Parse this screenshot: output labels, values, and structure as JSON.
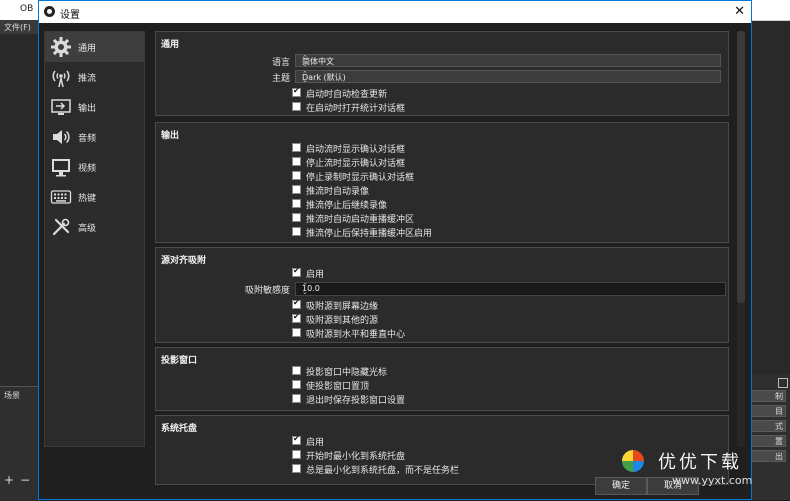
{
  "app": {
    "title_fragment": "OB",
    "menu_file": "文件(F)",
    "scenes_label": "场景",
    "scenes_add": "+",
    "scenes_remove": "−",
    "right_panel_fragments": [
      "制",
      "目",
      "式",
      "置",
      "出"
    ]
  },
  "dialog": {
    "title": "设置",
    "close": "✕",
    "ok_label": "确定",
    "cancel_label": "取消"
  },
  "sidebar": {
    "items": [
      {
        "label": "通用",
        "icon": "gear-icon",
        "active": true
      },
      {
        "label": "推流",
        "icon": "broadcast-tower-icon",
        "active": false
      },
      {
        "label": "输出",
        "icon": "output-monitor-icon",
        "active": false
      },
      {
        "label": "音频",
        "icon": "speaker-icon",
        "active": false
      },
      {
        "label": "视频",
        "icon": "display-icon",
        "active": false
      },
      {
        "label": "热键",
        "icon": "keyboard-icon",
        "active": false
      },
      {
        "label": "高级",
        "icon": "wrench-screwdriver-icon",
        "active": false
      }
    ]
  },
  "general": {
    "title": "通用",
    "language_label": "语言",
    "language_value": "简体中文",
    "theme_label": "主题",
    "theme_value": "Dark (默认)",
    "check_updates": {
      "label": "启动时自动检查更新",
      "checked": true
    },
    "open_stats": {
      "label": "在启动时打开统计对话框",
      "checked": false
    }
  },
  "output": {
    "title": "输出",
    "options": [
      {
        "label": "启动流时显示确认对话框",
        "checked": false
      },
      {
        "label": "停止流时显示确认对话框",
        "checked": false
      },
      {
        "label": "停止录制时显示确认对话框",
        "checked": false
      },
      {
        "label": "推流时自动录像",
        "checked": false
      },
      {
        "label": "推流停止后继续录像",
        "checked": false
      },
      {
        "label": "推流时自动启动重播缓冲区",
        "checked": false
      },
      {
        "label": "推流停止后保持重播缓冲区启用",
        "checked": false
      }
    ]
  },
  "snapping": {
    "title": "源对齐吸附",
    "enable": {
      "label": "启用",
      "checked": true
    },
    "sensitivity_label": "吸附敏感度",
    "sensitivity_value": "10.0",
    "options": [
      {
        "label": "吸附源到屏幕边缘",
        "checked": true
      },
      {
        "label": "吸附源到其他的源",
        "checked": true
      },
      {
        "label": "吸附源到水平和垂直中心",
        "checked": false
      }
    ]
  },
  "projectors": {
    "title": "投影窗口",
    "options": [
      {
        "label": "投影窗口中隐藏光标",
        "checked": false
      },
      {
        "label": "使投影窗口置顶",
        "checked": false
      },
      {
        "label": "退出时保存投影窗口设置",
        "checked": false
      }
    ]
  },
  "tray": {
    "title": "系统托盘",
    "options": [
      {
        "label": "启用",
        "checked": true
      },
      {
        "label": "开始时最小化到系统托盘",
        "checked": false
      },
      {
        "label": "总是最小化到系统托盘，而不是任务栏",
        "checked": false
      }
    ]
  },
  "watermark": {
    "title": "优优下载",
    "url": "www.yyxt.com"
  }
}
